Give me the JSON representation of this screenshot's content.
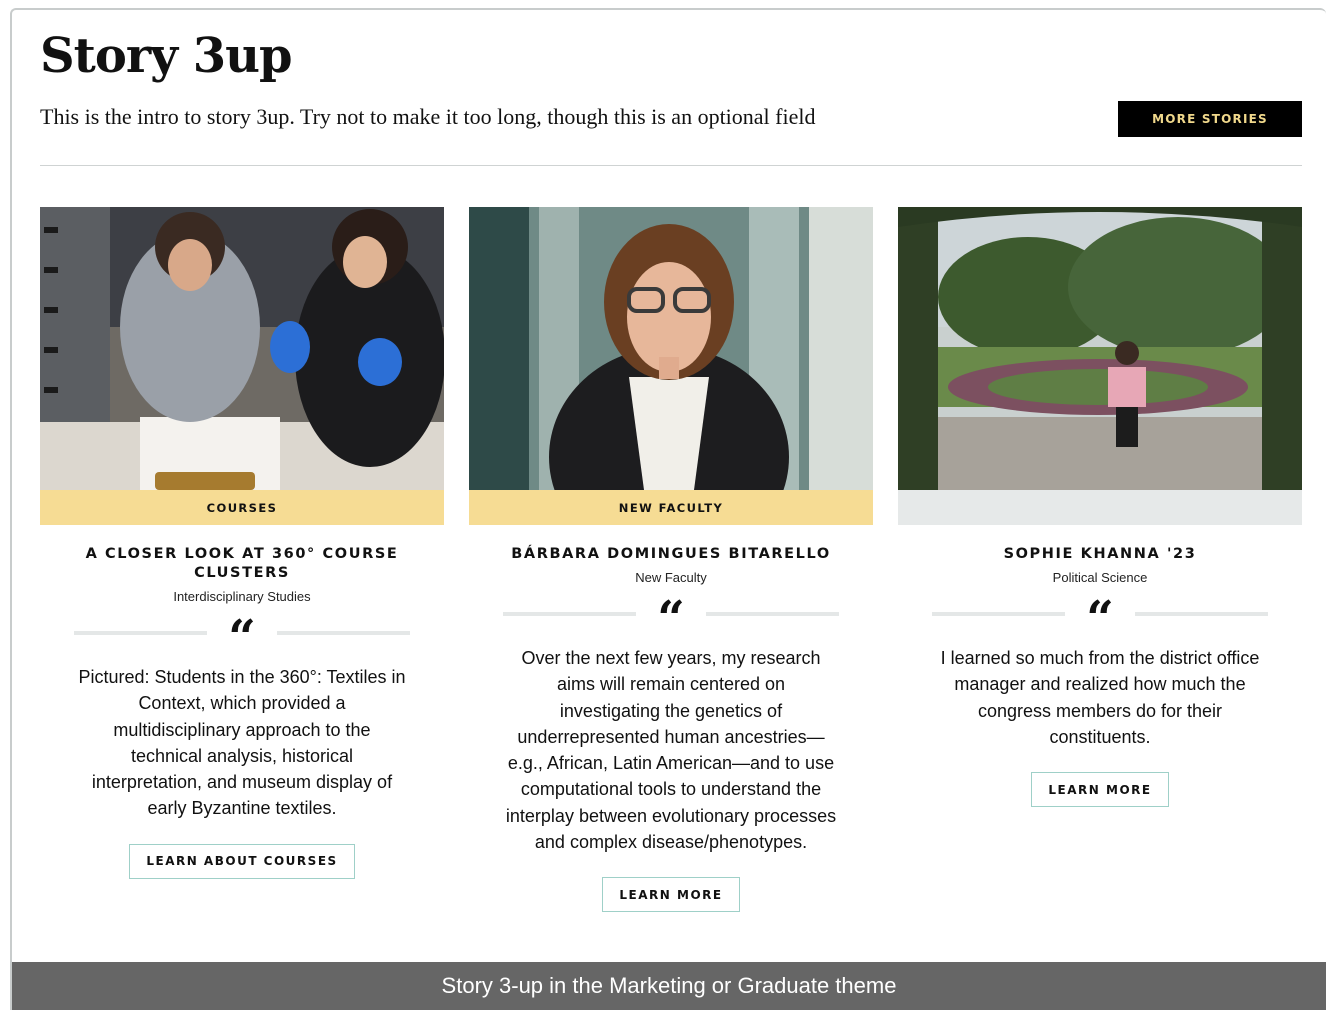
{
  "header": {
    "title": "Story 3up",
    "intro": "This is the intro to story 3up. Try not to make it too long, though this is an optional field",
    "more_label": "MORE STORIES"
  },
  "cards": [
    {
      "image_alt": "students-examining-textile-photo",
      "tag": "COURSES",
      "name": "A CLOSER LOOK AT 360° COURSE CLUSTERS",
      "sub": "Interdisciplinary Studies",
      "body": "Pictured: Students in the 360°: Textiles in Context, which provided a multidisciplinary approach to the technical analysis, historical interpretation, and museum display of early Byzantine textiles.",
      "button": "LEARN ABOUT COURSES"
    },
    {
      "image_alt": "faculty-portrait-photo",
      "tag": "NEW FACULTY",
      "name": "BÁRBARA DOMINGUES BITARELLO",
      "sub": "New Faculty",
      "body": "Over the next few years, my research aims will remain centered on investigating the genetics of underrepresented human ancestries—e.g., African, Latin American—and to use computational tools to understand the interplay between evolutionary processes and complex disease/phenotypes.",
      "button": "LEARN MORE"
    },
    {
      "image_alt": "student-in-garden-photo",
      "tag": "",
      "name": "SOPHIE KHANNA '23",
      "sub": "Political Science",
      "body": "I learned so much from the district office manager and realized how much the congress members do for their constituents.",
      "button": "LEARN MORE"
    }
  ],
  "quote_glyph": "“",
  "caption": "Story 3-up in the Marketing or Graduate theme",
  "colors": {
    "tag": "#f6dc94",
    "button_dark": "#000000",
    "button_dark_text": "#f1d98c",
    "outline": "#9fd0c8",
    "caption_bg": "#666666"
  }
}
